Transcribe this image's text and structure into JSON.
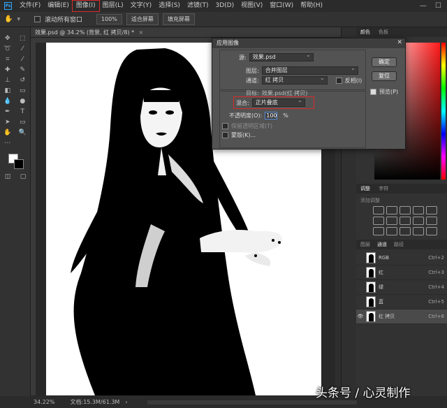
{
  "menubar": {
    "logo": "Ps",
    "items": [
      "文件(F)",
      "编辑(E)",
      "图像(I)",
      "图层(L)",
      "文字(Y)",
      "选择(S)",
      "滤镜(T)",
      "3D(D)",
      "视图(V)",
      "窗口(W)",
      "帮助(H)"
    ],
    "active_index": 2
  },
  "options": {
    "scroll_all_label": "滚动所有窗口",
    "zoom_label": "100%",
    "fit_screen_label": "适合屏幕",
    "fill_screen_label": "填充屏幕"
  },
  "document": {
    "tab_title": "效果.psd @ 34.2% (背景, 红 拷贝/8) *",
    "close": "×"
  },
  "dialog": {
    "title": "应用图像",
    "close": "✕",
    "source_label": "源:",
    "source_value": "效果.psd",
    "layer_label": "图层:",
    "layer_value": "合并图层",
    "channel_label": "通道:",
    "channel_value": "红 拷贝",
    "invert_label": "反相(I)",
    "target_label": "目标:",
    "target_value": "效果.psd(红 拷贝)",
    "blend_label": "混合:",
    "blend_value": "正片叠底",
    "opacity_label": "不透明度(O):",
    "opacity_value": "100",
    "opacity_unit": "%",
    "preserve_label": "保留透明区域(T)",
    "mask_label": "蒙版(K)...",
    "ok_label": "确定",
    "reset_label": "复位",
    "preview_label": "预览(P)"
  },
  "panels": {
    "color_tabs": [
      "颜色",
      "色板"
    ],
    "adjust_tabs": [
      "调整",
      "字符"
    ],
    "adjust_subtitle": "添加调整",
    "channel_tabs": [
      "图层",
      "通道",
      "路径"
    ],
    "channels": [
      {
        "name": "RGB",
        "key": "Ctrl+2",
        "visible": false,
        "selected": false
      },
      {
        "name": "红",
        "key": "Ctrl+3",
        "visible": false,
        "selected": false
      },
      {
        "name": "绿",
        "key": "Ctrl+4",
        "visible": false,
        "selected": false
      },
      {
        "name": "蓝",
        "key": "Ctrl+5",
        "visible": false,
        "selected": false
      },
      {
        "name": "红 拷贝",
        "key": "Ctrl+6",
        "visible": true,
        "selected": true
      }
    ]
  },
  "status": {
    "zoom": "34.22%",
    "doc_info": "文档:15.3M/61.3M"
  },
  "watermark": "头条号 / 心灵制作"
}
